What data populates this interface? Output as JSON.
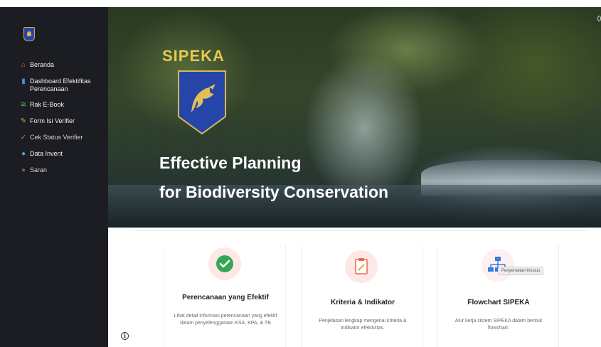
{
  "sidebar": {
    "items": [
      {
        "label": "Beranda",
        "icon": "home-icon"
      },
      {
        "label": "Dashboard Efektifitas Perencanaan",
        "icon": "chart-icon"
      },
      {
        "label": "Rak E-Book",
        "icon": "books-icon"
      },
      {
        "label": "Form Isi Verifier",
        "icon": "form-icon"
      },
      {
        "label": "Cek Status Verifier",
        "icon": "check-icon"
      },
      {
        "label": "Data Invent",
        "icon": "globe-icon"
      },
      {
        "label": "Saran",
        "icon": "comment-icon"
      }
    ]
  },
  "hero": {
    "brand": "SIPEKA",
    "title_line1": "Effective Planning",
    "title_line2": "for Biodiversity Conservation"
  },
  "cards": [
    {
      "title": "Perencanaan yang Efektif",
      "description": "Lihat detail informasi perencanaan yang efektif dalam penyelenggaraan KSA, KPA, & TB",
      "icon": "check-circle-icon"
    },
    {
      "title": "Kriteria & Indikator",
      "description": "Penjelasan lengkap mengenai kriteria & indikator efektivitas.",
      "icon": "clipboard-icon"
    },
    {
      "title": "Flowchart SIPEKA",
      "description": "Alur kerja sistem SIPEKA dalam bentuk flowchart.",
      "icon": "flowchart-icon"
    }
  ],
  "tooltip": "Penyematan khusus",
  "colors": {
    "sidebar_bg": "#1c1d22",
    "brand_gold": "#e6c84f",
    "shield_blue": "#2546a8",
    "check_green": "#34a853"
  }
}
